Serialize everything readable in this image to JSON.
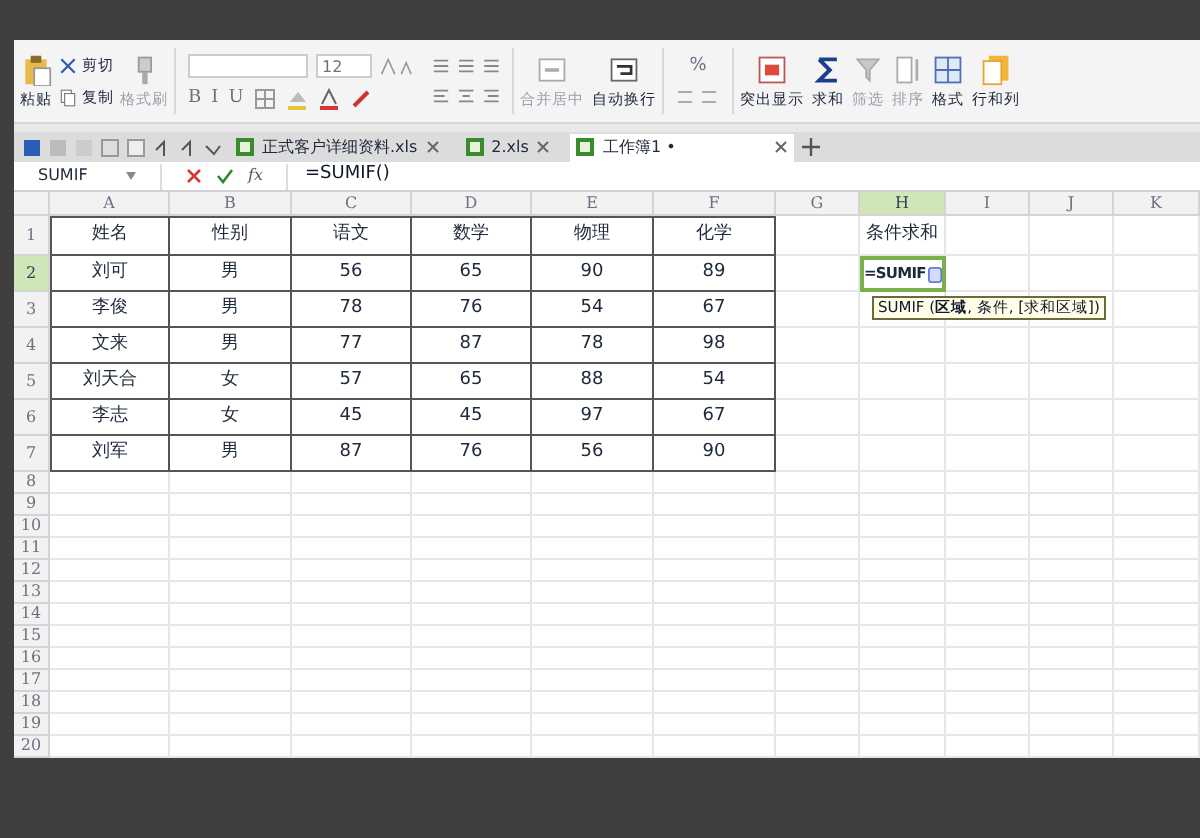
{
  "ribbon": {
    "clipboard": [
      {
        "label": "粘贴",
        "kind": "large",
        "disabled": false
      },
      {
        "label": "剪切",
        "kind": "small",
        "disabled": false
      },
      {
        "label": "复制",
        "kind": "small",
        "disabled": false
      },
      {
        "label": "格式刷",
        "kind": "large",
        "disabled": true
      }
    ],
    "font_size": "12",
    "styles": [
      "B",
      "I",
      "U"
    ],
    "cells": [
      {
        "label": "合并居中",
        "kind": "large",
        "disabled": true
      },
      {
        "label": "自动换行",
        "kind": "large",
        "disabled": false
      }
    ],
    "number_format": "%",
    "data": [
      {
        "label": "突出显示",
        "kind": "large",
        "disabled": false
      },
      {
        "label": "求和",
        "kind": "large",
        "disabled": false
      },
      {
        "label": "筛选",
        "kind": "large",
        "disabled": true
      },
      {
        "label": "排序",
        "kind": "large",
        "disabled": true
      },
      {
        "label": "格式",
        "kind": "large",
        "disabled": false
      },
      {
        "label": "行和列",
        "kind": "large",
        "disabled": false
      }
    ]
  },
  "tabs": [
    {
      "label": "正式客户详细资料.xls",
      "selected": false
    },
    {
      "label": "2.xls",
      "selected": false
    },
    {
      "label": "工作簿1 •",
      "selected": true
    }
  ],
  "formula_bar": {
    "name_box": "SUMIF",
    "function_button": "fx",
    "value": "=SUMIF()"
  },
  "sheet": {
    "columns": [
      {
        "label": "A",
        "selected": false
      },
      {
        "label": "B",
        "selected": false
      },
      {
        "label": "C",
        "selected": false
      },
      {
        "label": "D",
        "selected": false
      },
      {
        "label": "E",
        "selected": false
      },
      {
        "label": "F",
        "selected": false
      },
      {
        "label": "G",
        "selected": false
      },
      {
        "label": "H",
        "selected": true
      },
      {
        "label": "I",
        "selected": false
      },
      {
        "label": "J",
        "selected": false
      },
      {
        "label": "K",
        "selected": false
      }
    ],
    "rows": [
      {
        "label": "1",
        "selected": false,
        "cells": [
          "姓名",
          "性别",
          "语文",
          "数学",
          "物理",
          "化学"
        ],
        "column_h": {
          "text": "条件求和",
          "editing": false
        }
      },
      {
        "label": "2",
        "selected": true,
        "cells": [
          "刘可",
          "男",
          "56",
          "65",
          "90",
          "89"
        ],
        "column_h": {
          "text": "=SUMIF",
          "editing": true
        }
      },
      {
        "label": "3",
        "selected": false,
        "cells": [
          "李俊",
          "男",
          "78",
          "76",
          "54",
          "67"
        ]
      },
      {
        "label": "4",
        "selected": false,
        "cells": [
          "文来",
          "男",
          "77",
          "87",
          "78",
          "98"
        ]
      },
      {
        "label": "5",
        "selected": false,
        "cells": [
          "刘天合",
          "女",
          "57",
          "65",
          "88",
          "54"
        ]
      },
      {
        "label": "6",
        "selected": false,
        "cells": [
          "李志",
          "女",
          "45",
          "45",
          "97",
          "67"
        ]
      },
      {
        "label": "7",
        "selected": false,
        "cells": [
          "刘军",
          "男",
          "87",
          "76",
          "56",
          "90"
        ]
      }
    ],
    "empty_rows": [
      "8",
      "9",
      "10",
      "11",
      "12",
      "13",
      "14",
      "15",
      "16",
      "17",
      "18",
      "19",
      "20"
    ],
    "tooltip": "SUMIF (**区域**, 条件, [求和区域])"
  }
}
